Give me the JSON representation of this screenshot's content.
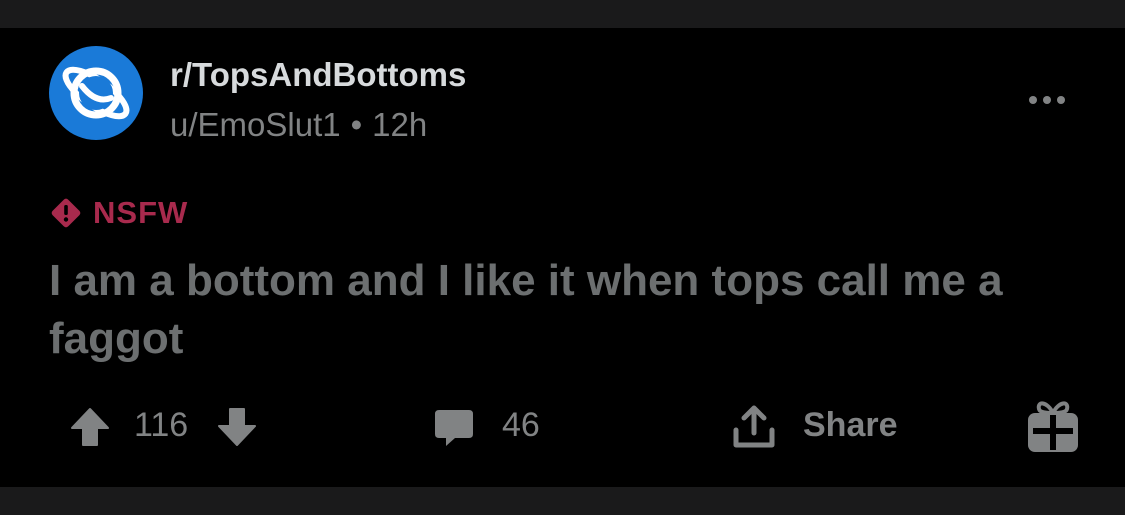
{
  "post": {
    "subreddit": "r/TopsAndBottoms",
    "author": "u/EmoSlut1",
    "separator": "•",
    "age": "12h",
    "flag": "NSFW",
    "title": "I am a bottom and I like it when tops call me a faggot"
  },
  "actions": {
    "score": "116",
    "comments": "46",
    "share_label": "Share"
  },
  "colors": {
    "background": "#000000",
    "band": "#1a1a1b",
    "avatar": "#1a7ad8",
    "nsfw": "#a82a4d",
    "muted": "#818384"
  },
  "icons": {
    "avatar": "planet-icon",
    "more": "more-options-icon",
    "nsfw": "warning-diamond-icon",
    "upvote": "upvote-arrow-icon",
    "downvote": "downvote-arrow-icon",
    "comment": "comment-bubble-icon",
    "share": "share-upload-icon",
    "award": "gift-award-icon"
  }
}
